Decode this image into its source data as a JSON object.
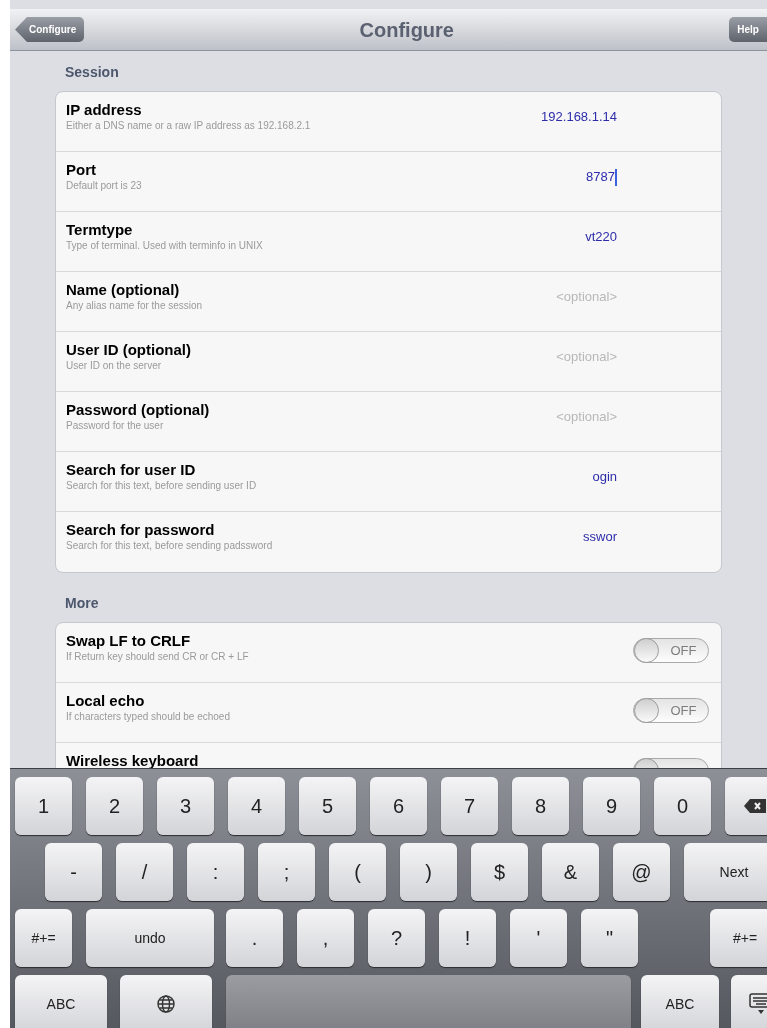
{
  "nav_bar": {
    "back_button": "Configure",
    "title": "Configure",
    "help_button": "Help"
  },
  "sections": [
    {
      "header": "Session",
      "rows": [
        {
          "kind": "text",
          "label": "IP address",
          "description": "Either a DNS name or a raw IP address as 192.168.2.1",
          "value": "192.168.1.14",
          "focused": false
        },
        {
          "kind": "text",
          "label": "Port",
          "description": "Default port is 23",
          "value": "8787",
          "focused": true
        },
        {
          "kind": "text",
          "label": "Termtype",
          "description": "Type of terminal. Used with terminfo in UNIX",
          "value": "vt220",
          "focused": false
        },
        {
          "kind": "text",
          "label": "Name (optional)",
          "description": "Any alias name for the session",
          "placeholder": "<optional>",
          "focused": false
        },
        {
          "kind": "text",
          "label": "User ID (optional)",
          "description": "User ID on the server",
          "placeholder": "<optional>",
          "focused": false
        },
        {
          "kind": "text",
          "label": "Password (optional)",
          "description": "Password for the user",
          "placeholder": "<optional>",
          "focused": false
        },
        {
          "kind": "text",
          "label": "Search for user ID",
          "description": "Search for this text, before sending user ID",
          "value": "ogin",
          "focused": false
        },
        {
          "kind": "text",
          "label": "Search for password",
          "description": "Search for this text, before sending padssword",
          "value": "sswor",
          "focused": false
        }
      ]
    },
    {
      "header": "More",
      "rows": [
        {
          "kind": "toggle",
          "label": "Swap LF to CRLF",
          "description": "If Return key should send CR or CR + LF",
          "on": false,
          "toggle_text": "OFF"
        },
        {
          "kind": "toggle",
          "label": "Local echo",
          "description": "If characters typed should be echoed",
          "on": false,
          "toggle_text": "OFF"
        },
        {
          "kind": "toggle",
          "label": "Wireless keyboard",
          "on": false
        }
      ]
    }
  ],
  "keyboard": {
    "rows": [
      [
        {
          "kind": "key",
          "label": "1"
        },
        {
          "kind": "key",
          "label": "2"
        },
        {
          "kind": "key",
          "label": "3"
        },
        {
          "kind": "key",
          "label": "4"
        },
        {
          "kind": "key",
          "label": "5"
        },
        {
          "kind": "key",
          "label": "6"
        },
        {
          "kind": "key",
          "label": "7"
        },
        {
          "kind": "key",
          "label": "8"
        },
        {
          "kind": "key",
          "label": "9"
        },
        {
          "kind": "key",
          "label": "0"
        },
        {
          "kind": "delete"
        }
      ],
      [
        {
          "kind": "key",
          "label": "-"
        },
        {
          "kind": "key",
          "label": "/"
        },
        {
          "kind": "key",
          "label": ":"
        },
        {
          "kind": "key",
          "label": ";"
        },
        {
          "kind": "key",
          "label": "("
        },
        {
          "kind": "key",
          "label": ")"
        },
        {
          "kind": "key",
          "label": "$"
        },
        {
          "kind": "key",
          "label": "&"
        },
        {
          "kind": "key",
          "label": "@"
        },
        {
          "kind": "key",
          "label": "Next"
        }
      ],
      [
        {
          "kind": "key",
          "label": "#+="
        },
        {
          "kind": "key",
          "label": "undo"
        },
        {
          "kind": "key",
          "label": "."
        },
        {
          "kind": "key",
          "label": ","
        },
        {
          "kind": "key",
          "label": "?"
        },
        {
          "kind": "key",
          "label": "!"
        },
        {
          "kind": "key",
          "label": "'"
        },
        {
          "kind": "key",
          "label": "\""
        },
        {
          "kind": "key",
          "label": "#+="
        }
      ],
      [
        {
          "kind": "key",
          "label": "ABC"
        },
        {
          "kind": "globe"
        },
        {
          "kind": "space"
        },
        {
          "kind": "key",
          "label": "ABC"
        },
        {
          "kind": "hide_keyboard"
        }
      ]
    ]
  }
}
